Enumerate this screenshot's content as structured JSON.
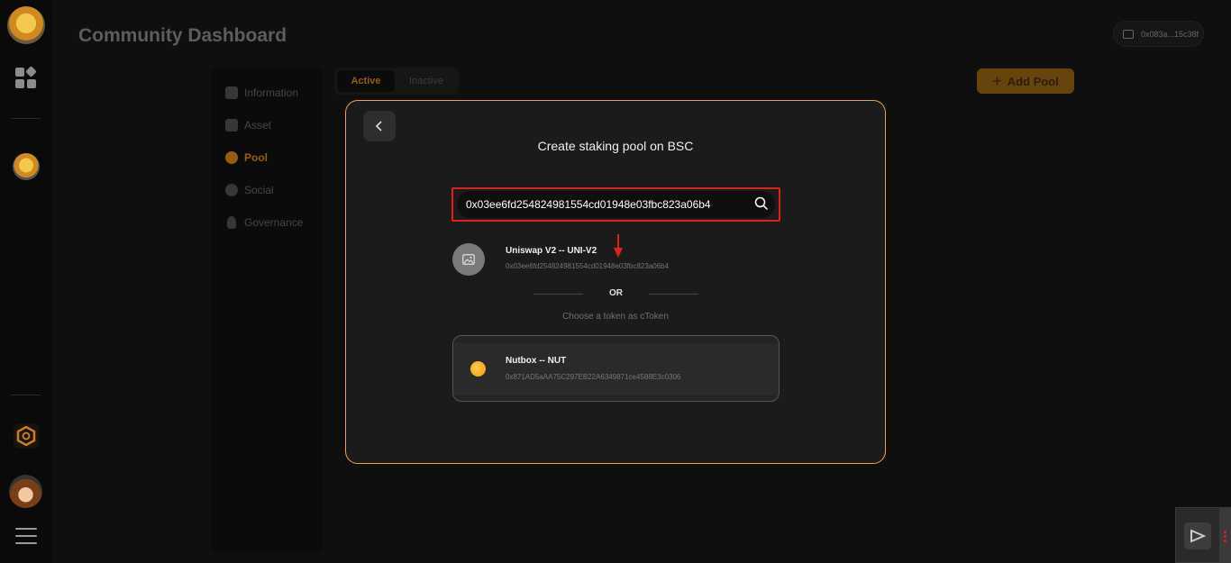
{
  "header": {
    "title": "Community Dashboard",
    "wallet_address": "0x083a...15c38f"
  },
  "rail": {
    "icons": [
      "logo-avatar",
      "apps-icon",
      "community-avatar",
      "hexagon-icon",
      "user-avatar",
      "menu-icon"
    ]
  },
  "subnav": {
    "items": [
      {
        "label": "Information",
        "icon": "home-icon",
        "active": false
      },
      {
        "label": "Asset",
        "icon": "chart-icon",
        "active": false
      },
      {
        "label": "Pool",
        "icon": "acorn-icon",
        "active": true
      },
      {
        "label": "Social",
        "icon": "share-icon",
        "active": false
      },
      {
        "label": "Governance",
        "icon": "bulb-icon",
        "active": false
      }
    ]
  },
  "tabs": {
    "active": "Active",
    "inactive": "Inactive"
  },
  "add_pool_label": "Add Pool",
  "modal": {
    "title": "Create staking pool on BSC",
    "search_value": "0x03ee6fd254824981554cd01948e03fbc823a06b4",
    "result": {
      "name": "Uniswap V2 -- UNI-V2",
      "address": "0x03ee6fd254824981554cd01948e03fbc823a06b4"
    },
    "or_label": "OR",
    "choose_label": "Choose a token as cToken",
    "token": {
      "name": "Nutbox -- NUT",
      "address": "0x871AD5aAA75C297EB22A6349871ce4588E3c0306"
    }
  },
  "colors": {
    "accent": "#c87d16",
    "modal_border": "#f0a050",
    "highlight_red": "#e0201c"
  }
}
